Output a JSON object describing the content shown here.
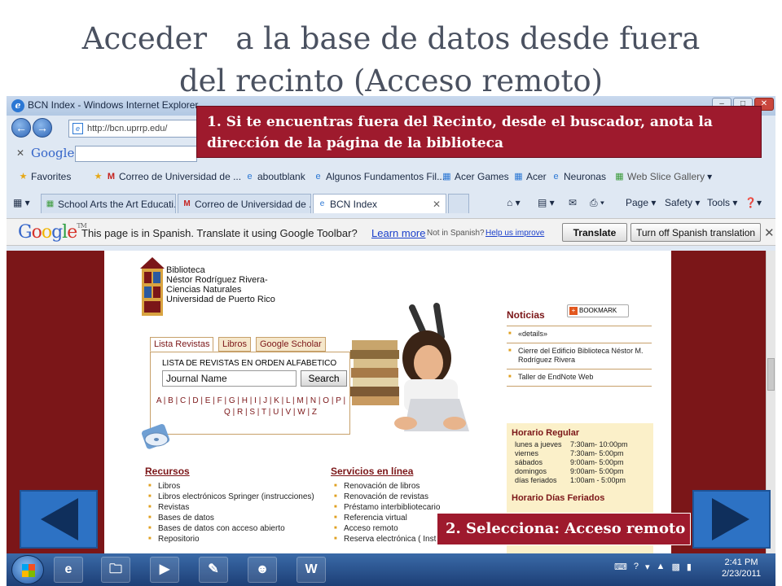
{
  "slide": {
    "title_line1": "Acceder   a la base de datos desde fuera",
    "title_line2": "del recinto (Acceso remoto)"
  },
  "browser": {
    "window_title": "BCN Index - Windows Internet Explorer",
    "address": "http://bcn.uprrp.edu/",
    "google_toolbar_label": "Google",
    "favorites": [
      {
        "label": "Favorites",
        "icon": "star-icon"
      },
      {
        "label": "Correo de Universidad de ...",
        "icon": "gmail-icon"
      },
      {
        "label": "aboutblank",
        "icon": "page-icon"
      },
      {
        "label": "Algunos Fundamentos Fil...",
        "icon": "page-icon"
      },
      {
        "label": "Acer Games",
        "icon": "page-icon"
      },
      {
        "label": "Acer",
        "icon": "page-icon"
      },
      {
        "label": "Neuronas",
        "icon": "page-icon"
      },
      {
        "label": "Web Slice Gallery",
        "icon": "slice-icon"
      }
    ],
    "tabs": [
      {
        "label": "School Arts the Art Educati..."
      },
      {
        "label": "Correo de Universidad de ..."
      },
      {
        "label": "BCN Index"
      }
    ],
    "commands": {
      "page": "Page",
      "safety": "Safety",
      "tools": "Tools"
    },
    "translate_bar": {
      "logo": "Google",
      "message": "This page is in Spanish.  Translate it using Google Toolbar?",
      "learn_more": "Learn more",
      "not_spanish": "Not in Spanish?",
      "help": "Help us improve",
      "translate_button": "Translate",
      "turn_off_button": "Turn off Spanish translation"
    }
  },
  "library": {
    "name_lines": [
      "Biblioteca",
      "Néstor Rodríguez Rivera-",
      "Ciencias Naturales",
      "Universidad de Puerto Rico"
    ],
    "search_tabs": [
      "Lista Revistas",
      "Libros",
      "Google Scholar"
    ],
    "search_label": "LISTA DE REVISTAS EN ORDEN ALFABETICO",
    "search_value": "Journal Name",
    "search_button": "Search",
    "alphabet_line1": "A | B | C | D | E | F | G | H | I | J | K | L | M | N | O | P |",
    "alphabet_line2": "Q | R | S | T | U | V | W | Z",
    "noticias": {
      "title": "Noticias",
      "bookmark": "BOOKMARK",
      "items": [
        "«details»",
        "Cierre del Edificio Biblioteca Néstor M. Rodríguez Rivera",
        "Taller de EndNote Web"
      ]
    },
    "horario": {
      "title": "Horario Regular",
      "rows": [
        {
          "day": "lunes a jueves",
          "hours": "7:30am- 10:00pm"
        },
        {
          "day": "viernes",
          "hours": "7:30am- 5:00pm"
        },
        {
          "day": "sábados",
          "hours": "9:00am- 5:00pm"
        },
        {
          "day": "domingos",
          "hours": "9:00am- 5:00pm"
        },
        {
          "day": "días feriados",
          "hours": "1:00am - 5:00pm"
        }
      ],
      "title2": "Horario Días Feriados"
    },
    "recursos": {
      "title": "Recursos",
      "items": [
        "Libros",
        "Libros electrónicos Springer (instrucciones)",
        "Revistas",
        "Bases de datos",
        "Bases de datos con acceso abierto",
        "Repositorio"
      ]
    },
    "servicios": {
      "title": "Servicios en línea",
      "items": [
        "Renovación de libros",
        "Renovación de revistas",
        "Préstamo interbibliotecario",
        "Referencia virtual",
        "Acceso remoto",
        "Reserva electrónica ( Instrucciones )"
      ]
    }
  },
  "taskbar": {
    "time": "2:41 PM",
    "date": "2/23/2011"
  },
  "callouts": {
    "step1": "1. Si te encuentras fuera del Recinto, desde el buscador, anota la dirección de la página de la biblioteca",
    "step2": "2. Selecciona:  Acceso remoto"
  },
  "colors": {
    "accent_red": "#9e1a2d",
    "nav_blue": "#2d72c4",
    "page_maroon": "#7b1618"
  }
}
